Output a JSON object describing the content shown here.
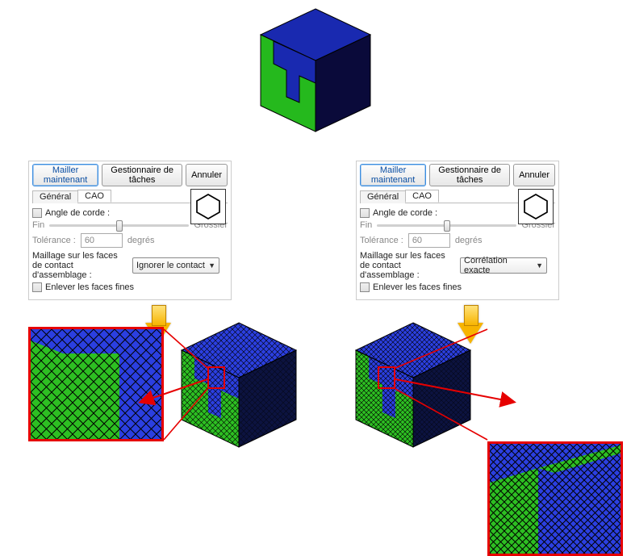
{
  "panel": {
    "buttons": {
      "mesh_now": "Mailler maintenant",
      "task_manager": "Gestionnaire de tâches",
      "cancel": "Annuler"
    },
    "tabs": {
      "general": "Général",
      "cad": "CAO"
    },
    "angle_label": "Angle de corde :",
    "fin": "Fin",
    "grossier": "Grossier",
    "tolerance_label": "Tolérance :",
    "tolerance_value": "60",
    "tolerance_unit": "degrés",
    "contact_label": "Maillage sur les faces de contact d'assemblage :",
    "remove_thin": "Enlever les faces fines"
  },
  "left": {
    "contact_option": "Ignorer le contact"
  },
  "right": {
    "contact_option": "Corrélation exacte"
  },
  "icons": {
    "hexagon": "hexagon-icon",
    "chevron_down": "▼"
  }
}
